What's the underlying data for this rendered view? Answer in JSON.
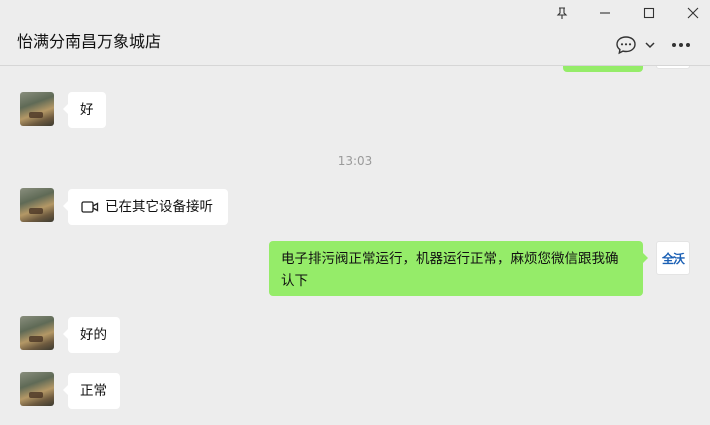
{
  "window": {
    "chat_title": "怡满分南昌万象城店"
  },
  "messages": [
    {
      "side": "left",
      "text": "好"
    },
    {
      "type": "timestamp",
      "text": "13:03"
    },
    {
      "side": "left",
      "text": "已在其它设备接听",
      "icon": "video-call-icon"
    },
    {
      "side": "right",
      "text": "电子排污阀正常运行，机器运行正常，麻烦您微信跟我确认下"
    },
    {
      "side": "left",
      "text": "好的"
    },
    {
      "side": "left",
      "text": "正常"
    }
  ],
  "self_avatar": {
    "text": "全沃"
  },
  "colors": {
    "background": "#ededed",
    "self_bubble": "#95ec69",
    "other_bubble": "#ffffff"
  }
}
